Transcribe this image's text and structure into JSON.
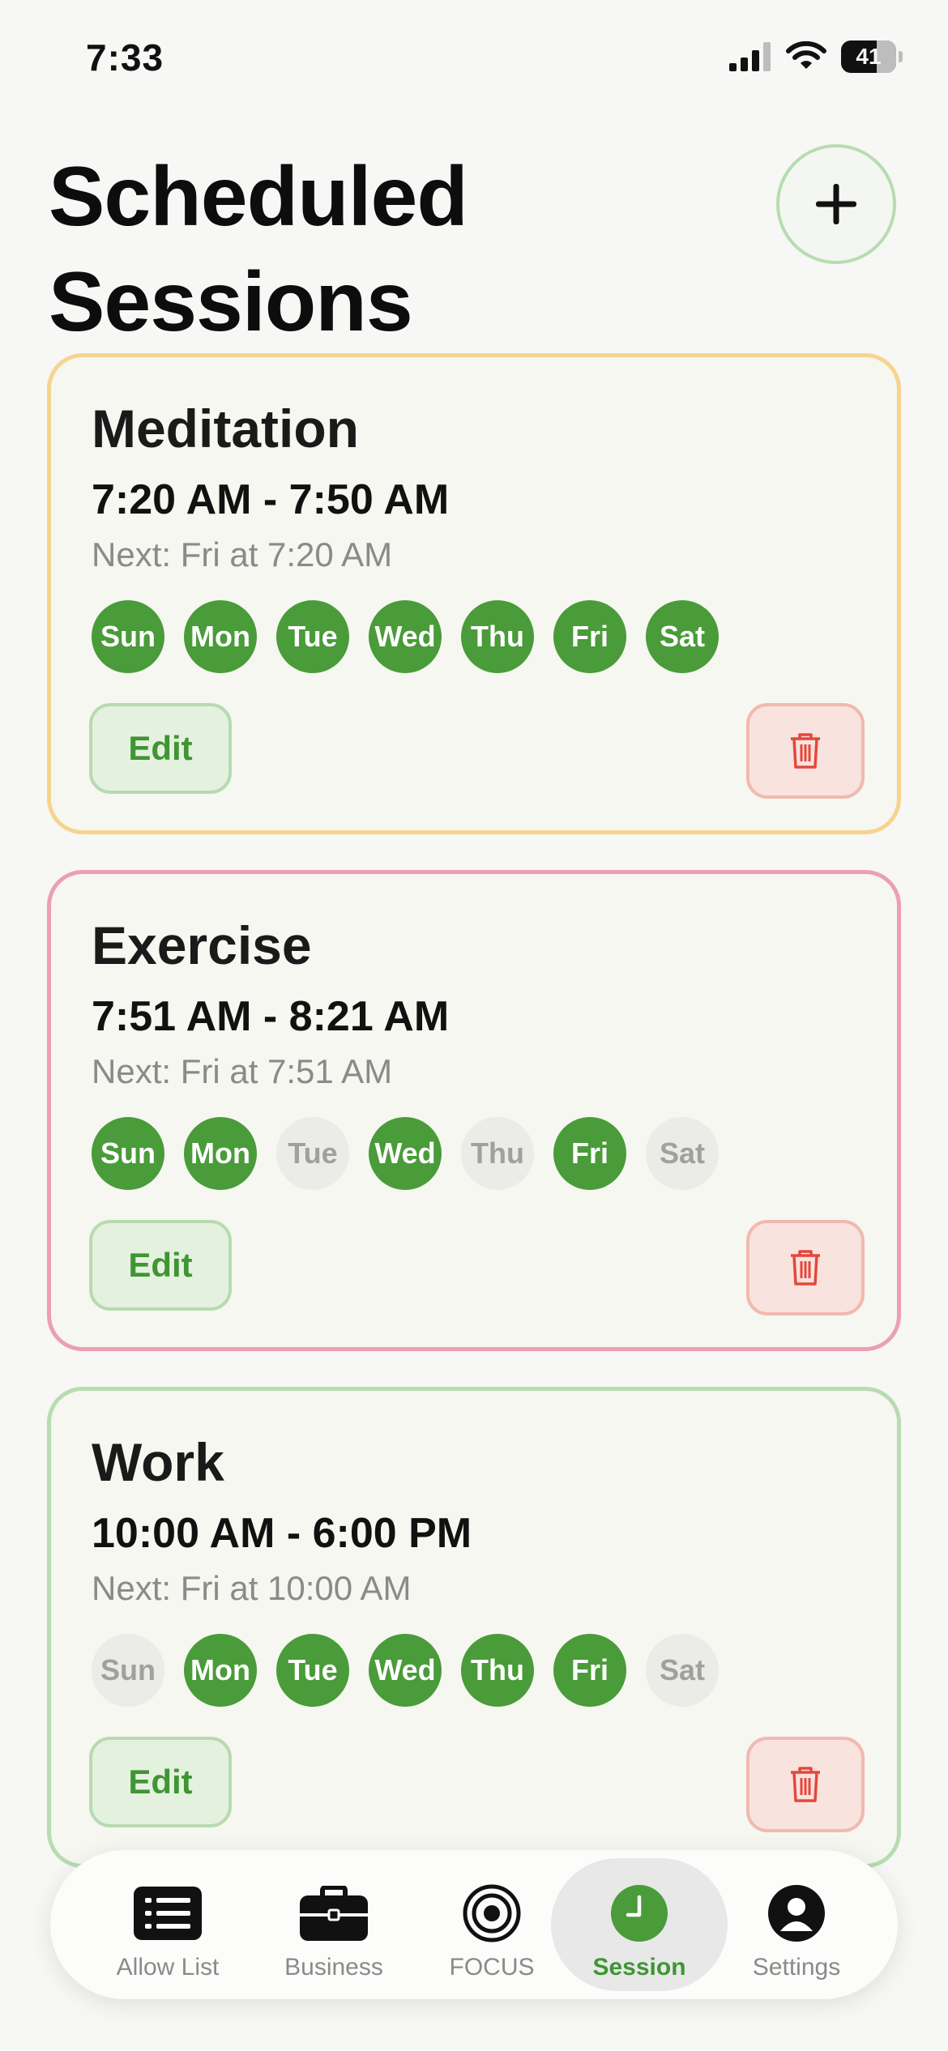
{
  "status_bar": {
    "time": "7:33",
    "battery": "41",
    "icons": [
      "cellular-signal-icon",
      "wifi-icon",
      "battery-icon"
    ]
  },
  "header": {
    "title": "Scheduled Sessions",
    "add_icon": "plus-icon"
  },
  "colors": {
    "accent_green": "#4a9b39",
    "day_off_bg": "#ebebe8",
    "card_border_meditation": "#f6d48e",
    "card_border_exercise": "#ec9fb4",
    "card_border_work": "#b7dcb1",
    "delete_red": "#e5473b"
  },
  "sessions": [
    {
      "name": "Meditation",
      "time": "7:20 AM - 7:50 AM",
      "next": "Next: Fri at 7:20 AM",
      "days": [
        {
          "label": "Sun",
          "active": true
        },
        {
          "label": "Mon",
          "active": true
        },
        {
          "label": "Tue",
          "active": true
        },
        {
          "label": "Wed",
          "active": true
        },
        {
          "label": "Thu",
          "active": true
        },
        {
          "label": "Fri",
          "active": true
        },
        {
          "label": "Sat",
          "active": true
        }
      ],
      "edit_label": "Edit",
      "delete_icon": "trash-icon"
    },
    {
      "name": "Exercise",
      "time": "7:51 AM - 8:21 AM",
      "next": "Next: Fri at 7:51 AM",
      "days": [
        {
          "label": "Sun",
          "active": true
        },
        {
          "label": "Mon",
          "active": true
        },
        {
          "label": "Tue",
          "active": false
        },
        {
          "label": "Wed",
          "active": true
        },
        {
          "label": "Thu",
          "active": false
        },
        {
          "label": "Fri",
          "active": true
        },
        {
          "label": "Sat",
          "active": false
        }
      ],
      "edit_label": "Edit",
      "delete_icon": "trash-icon"
    },
    {
      "name": "Work",
      "time": "10:00 AM - 6:00 PM",
      "next": "Next: Fri at 10:00 AM",
      "days": [
        {
          "label": "Sun",
          "active": false
        },
        {
          "label": "Mon",
          "active": true
        },
        {
          "label": "Tue",
          "active": true
        },
        {
          "label": "Wed",
          "active": true
        },
        {
          "label": "Thu",
          "active": true
        },
        {
          "label": "Fri",
          "active": true
        },
        {
          "label": "Sat",
          "active": false
        }
      ],
      "edit_label": "Edit",
      "delete_icon": "trash-icon"
    }
  ],
  "tab_bar": {
    "tabs": [
      {
        "label": "Allow List",
        "icon": "list-icon",
        "active": false
      },
      {
        "label": "Business",
        "icon": "briefcase-icon",
        "active": false
      },
      {
        "label": "FOCUS",
        "icon": "target-icon",
        "active": false
      },
      {
        "label": "Session",
        "icon": "clock-icon",
        "active": true
      },
      {
        "label": "Settings",
        "icon": "person-icon",
        "active": false
      }
    ]
  }
}
